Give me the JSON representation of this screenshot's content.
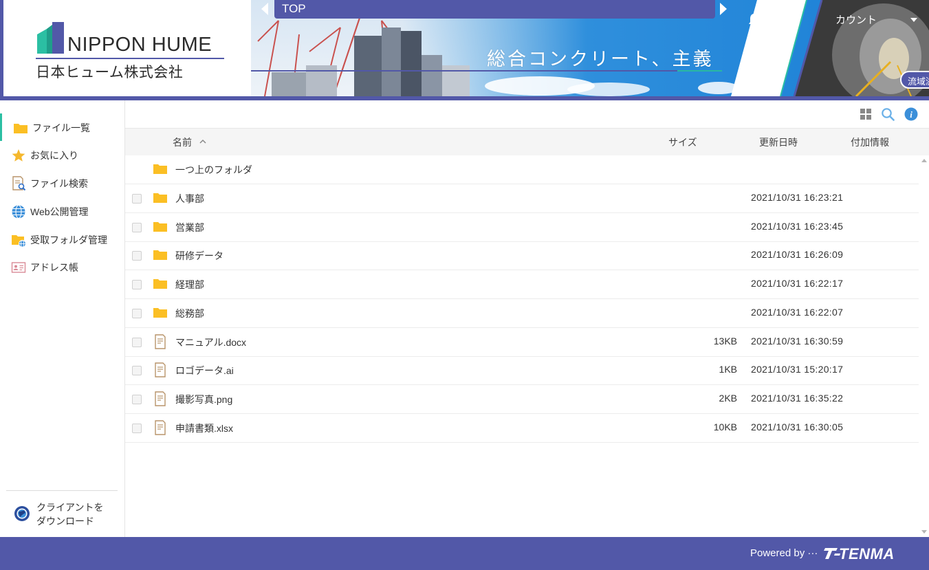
{
  "header": {
    "logo_en": "NIPPON HUME",
    "logo_ja": "日本ヒューム株式会社",
    "slogan": "総合コンクリート、主義",
    "breadcrumb_top": "TOP",
    "account_label": "カウント",
    "tag_label": "流域溢"
  },
  "sidebar": {
    "items": [
      {
        "label": "ファイル一覧",
        "icon": "folder-icon"
      },
      {
        "label": "お気に入り",
        "icon": "star-icon"
      },
      {
        "label": "ファイル検索",
        "icon": "file-search-icon"
      },
      {
        "label": "Web公開管理",
        "icon": "globe-icon"
      },
      {
        "label": "受取フォルダ管理",
        "icon": "receive-folder-icon"
      },
      {
        "label": "アドレス帳",
        "icon": "address-book-icon"
      }
    ],
    "client_download": "クライアントを\nダウンロード"
  },
  "table": {
    "headers": {
      "name": "名前",
      "size": "サイズ",
      "updated": "更新日時",
      "extra": "付加情報"
    },
    "parent_folder": "一つ上のフォルダ",
    "rows": [
      {
        "name": "人事部",
        "type": "folder",
        "size": "",
        "updated": "2021/10/31 16:23:21"
      },
      {
        "name": "営業部",
        "type": "folder",
        "size": "",
        "updated": "2021/10/31 16:23:45"
      },
      {
        "name": "研修データ",
        "type": "folder",
        "size": "",
        "updated": "2021/10/31 16:26:09"
      },
      {
        "name": "経理部",
        "type": "folder",
        "size": "",
        "updated": "2021/10/31 16:22:17"
      },
      {
        "name": "総務部",
        "type": "folder",
        "size": "",
        "updated": "2021/10/31 16:22:07"
      },
      {
        "name": "マニュアル.docx",
        "type": "file",
        "size": "13KB",
        "updated": "2021/10/31 16:30:59"
      },
      {
        "name": "ロゴデータ.ai",
        "type": "file",
        "size": "1KB",
        "updated": "2021/10/31 15:20:17"
      },
      {
        "name": "撮影写真.png",
        "type": "file",
        "size": "2KB",
        "updated": "2021/10/31 16:35:22"
      },
      {
        "name": "申請書類.xlsx",
        "type": "file",
        "size": "10KB",
        "updated": "2021/10/31 16:30:05"
      }
    ]
  },
  "footer": {
    "powered_by": "Powered by ···",
    "brand": "TENMA"
  },
  "colors": {
    "brand": "#5258a8",
    "accent": "#2bbfa3",
    "folder": "#fbbf24",
    "info": "#3b8fd9"
  }
}
